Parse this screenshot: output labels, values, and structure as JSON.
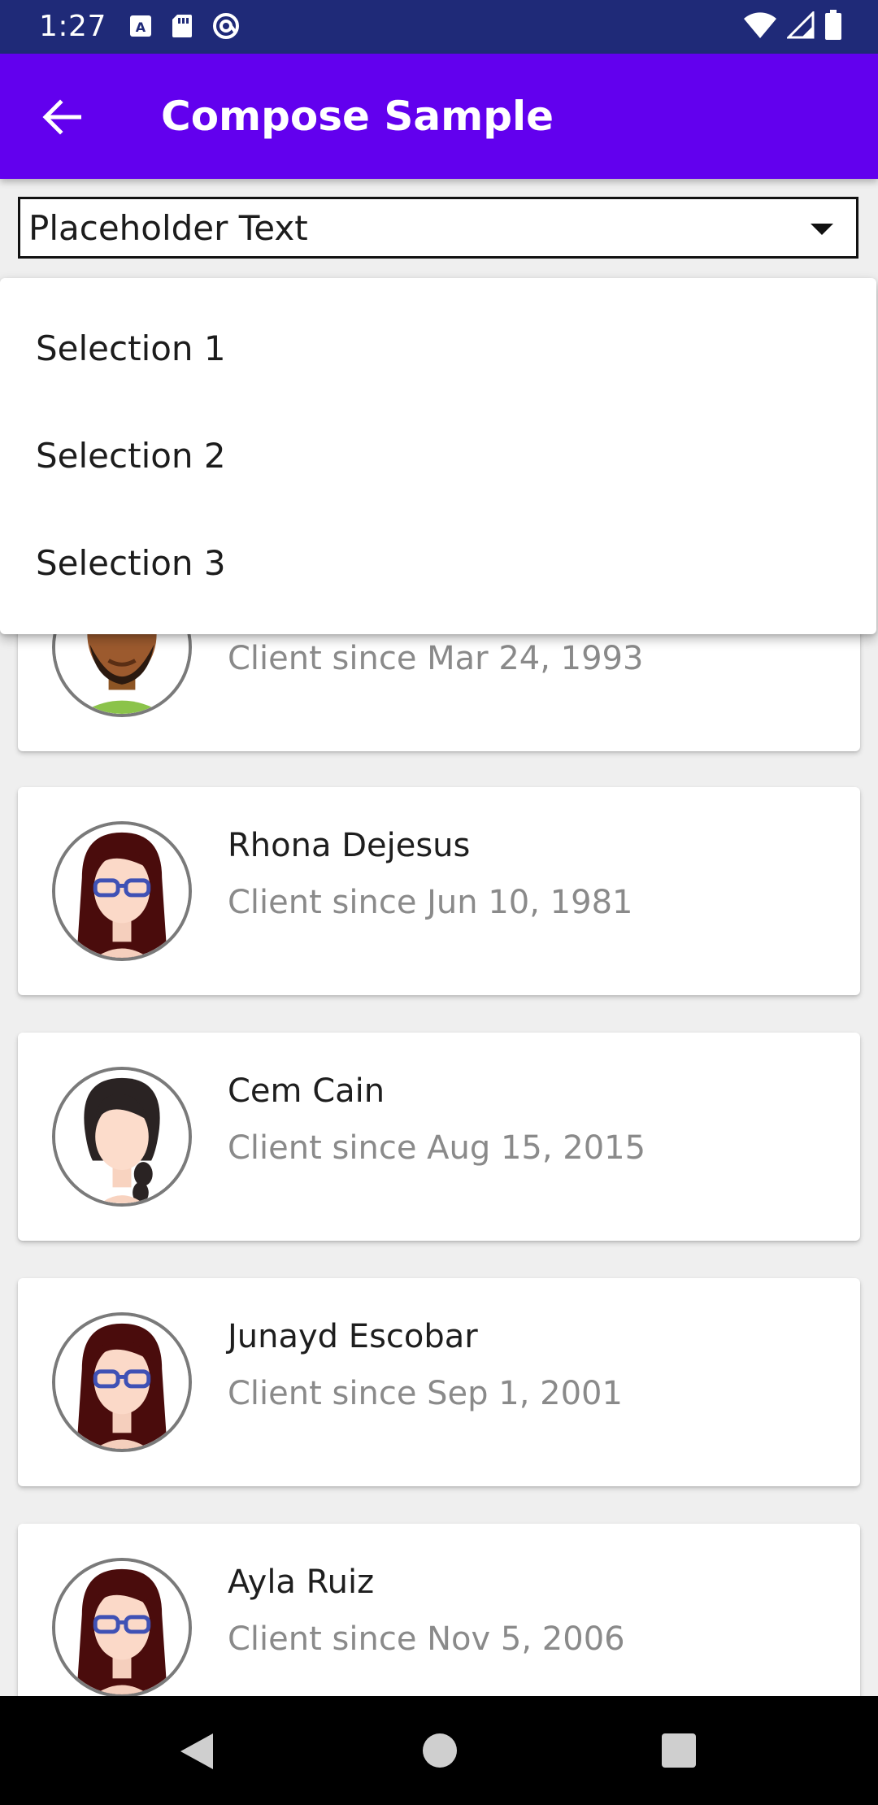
{
  "status_bar": {
    "time": "1:27",
    "left_icons": [
      "a-box-icon",
      "sd-card-icon",
      "at-sign-icon"
    ],
    "right_icons": [
      "wifi-icon",
      "cellular-signal-icon",
      "battery-icon"
    ]
  },
  "app_bar": {
    "title": "Compose Sample",
    "background": "#6200ee"
  },
  "dropdown": {
    "value": "Placeholder Text",
    "options": [
      "Selection 1",
      "Selection 2",
      "Selection 3"
    ]
  },
  "clients": [
    {
      "name": "",
      "since": "Client since Mar 24, 1993",
      "avatar": "man-beard-avatar"
    },
    {
      "name": "Rhona Dejesus",
      "since": "Client since Jun 10, 1981",
      "avatar": "woman-glasses-avatar"
    },
    {
      "name": "Cem Cain",
      "since": "Client since Aug 15, 2015",
      "avatar": "woman-braid-avatar"
    },
    {
      "name": "Junayd Escobar",
      "since": "Client since Sep 1, 2001",
      "avatar": "woman-glasses-avatar"
    },
    {
      "name": "Ayla Ruiz",
      "since": "Client since Nov 5, 2006",
      "avatar": "woman-glasses-avatar"
    }
  ],
  "nav_bar": {
    "buttons": [
      "back-icon",
      "home-icon",
      "recents-icon"
    ]
  }
}
